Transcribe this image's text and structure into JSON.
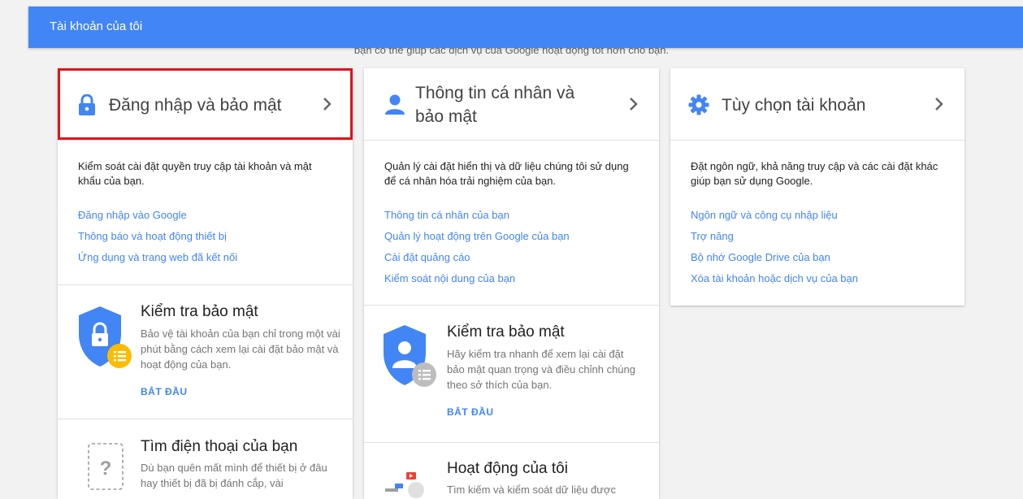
{
  "header": {
    "title": "Tài khoản của tôi"
  },
  "intro_text": "bạn có thể giúp các dịch vụ của Google hoạt động tốt hơn cho bạn.",
  "cards": [
    {
      "title": "Đăng nhập và bảo mật",
      "description": "Kiểm soát cài đặt quyền truy cập tài khoản và mật khẩu của bạn.",
      "links": [
        "Đăng nhập vào Google",
        "Thông báo và hoạt động thiết bị",
        "Ứng dụng và trang web đã kết nối"
      ],
      "sections": [
        {
          "title": "Kiểm tra bảo mật",
          "description": "Bảo vệ tài khoản của bạn chỉ trong một vài phút bằng cách xem lại cài đặt bảo mật và hoạt động của bạn.",
          "button": "BẮT ĐẦU"
        },
        {
          "title": "Tìm điện thoại của bạn",
          "description": "Dù bạn quên mất mình để thiết bị ở đâu hay thiết bị đã bị đánh cắp, vài"
        }
      ]
    },
    {
      "title_line1": "Thông tin cá nhân và",
      "title_line2": "bảo mật",
      "description": "Quản lý cài đặt hiển thị và dữ liệu chúng tôi sử dụng để cá nhân hóa trải nghiệm của bạn.",
      "links": [
        "Thông tin cá nhân của bạn",
        "Quản lý hoạt động trên Google của bạn",
        "Cài đặt quảng cáo",
        "Kiểm soát nội dung của bạn"
      ],
      "sections": [
        {
          "title": "Kiểm tra bảo mật",
          "description": "Hãy kiểm tra nhanh để xem lại cài đặt bảo mật quan trọng và điều chỉnh chúng theo sở thích của bạn.",
          "button": "BẮT ĐẦU"
        },
        {
          "title": "Hoạt động của tôi",
          "description": "Tìm kiếm và kiểm soát dữ liệu được"
        }
      ]
    },
    {
      "title": "Tùy chọn tài khoản",
      "description": "Đặt ngôn ngữ, khả năng truy cập và các cài đặt khác giúp bạn sử dụng Google.",
      "links": [
        "Ngôn ngữ và công cụ nhập liệu",
        "Trợ năng",
        "Bộ nhớ Google Drive của bạn",
        "Xóa tài khoản hoặc dịch vụ của bạn"
      ]
    }
  ],
  "colors": {
    "header_bg": "#4285f4",
    "link": "#4285f4",
    "highlight": "#e0141d"
  }
}
